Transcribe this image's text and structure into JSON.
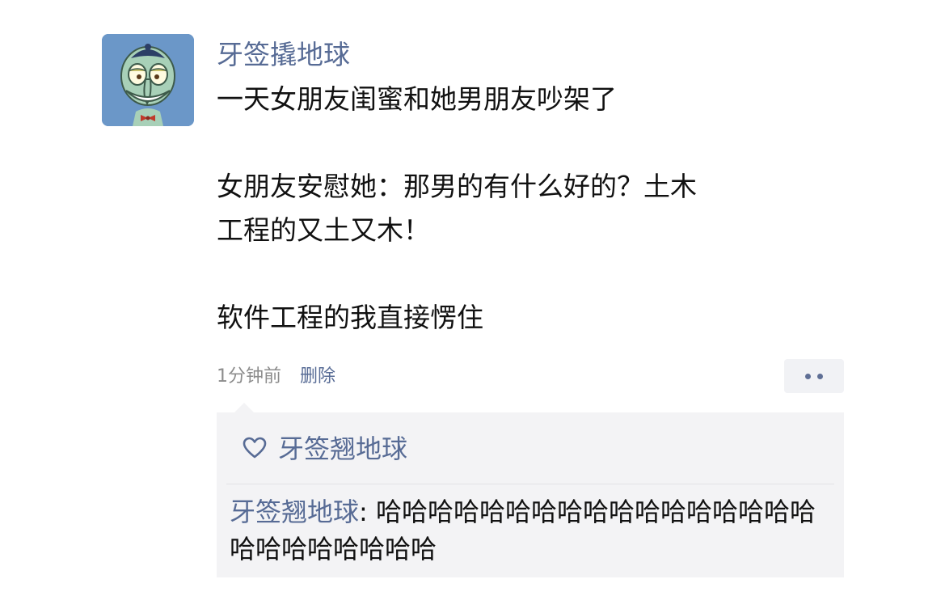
{
  "post": {
    "nickname": "牙签撬地球",
    "avatar_icon": "squidward-avatar-icon",
    "paragraphs": [
      "一天女朋友闺蜜和她男朋友吵架了",
      "女朋友安慰她：那男的有什么好的？土木\n工程的又土又木！",
      "软件工程的我直接愣住"
    ],
    "time": "1分钟前",
    "delete_label": "删除",
    "more_icon": "more-dots-icon"
  },
  "interactions": {
    "like_icon": "heart-icon",
    "liked_by": "牙签翘地球",
    "comments": [
      {
        "author": "牙签翘地球",
        "separator": ": ",
        "text": "哈哈哈哈哈哈哈哈哈哈哈哈哈哈哈哈哈哈哈哈哈哈哈哈哈"
      }
    ]
  },
  "colors": {
    "link": "#576b95",
    "text": "#111111",
    "meta": "#8c8c8c",
    "comment_bg": "#f3f3f5",
    "avatar_bg": "#6b97c8"
  }
}
